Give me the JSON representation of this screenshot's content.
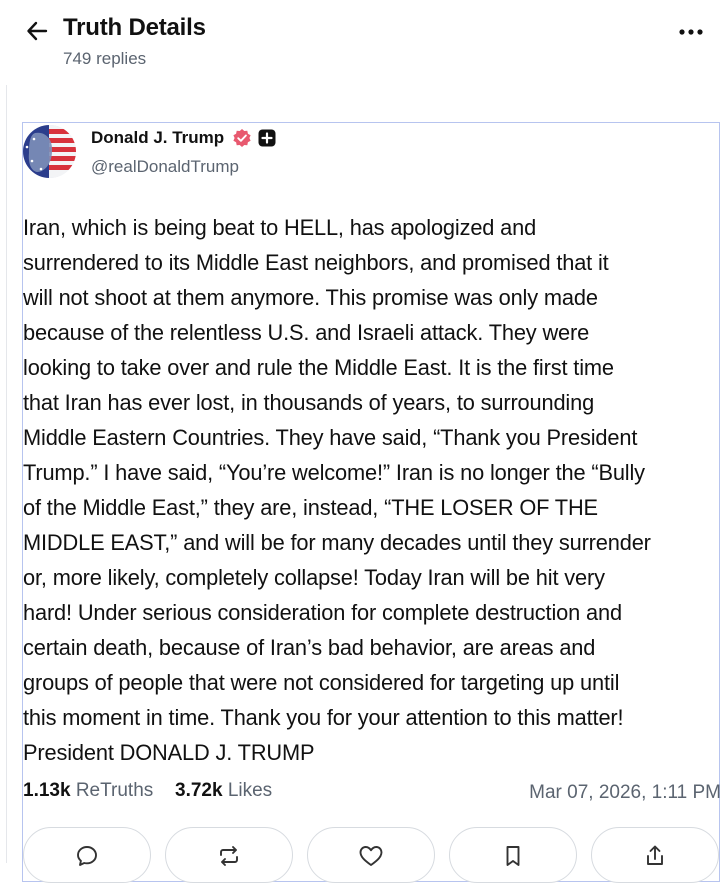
{
  "header": {
    "title": "Truth Details",
    "subtitle": "749 replies",
    "back_icon": "arrow-left-icon",
    "more_icon": "more-horizontal-icon"
  },
  "post": {
    "author": {
      "name": "Donald J. Trump",
      "handle": "@realDonaldTrump",
      "verified_icon": "verified-badge-icon",
      "plus_icon": "plus-square-icon"
    },
    "text": "Iran, which is being beat to HELL, has apologized and\nsurrendered to its Middle East neighbors, and promised that it\nwill not shoot at them anymore. This promise was only made\nbecause of the relentless U.S. and Israeli attack. They were\nlooking to take over and rule the Middle East. It is the first time\nthat Iran has ever lost, in thousands of years, to surrounding\nMiddle Eastern Countries. They have said, “Thank you President\nTrump.” I have said, “You’re welcome!” Iran is no longer the “Bully\nof the Middle East,” they are, instead, “THE LOSER OF THE\nMIDDLE EAST,” and will be for many decades until they surrender\nor, more likely, completely collapse! Today Iran will be hit very\nhard! Under serious consideration for complete destruction and\ncertain death, because of Iran’s bad behavior, are areas and\ngroups of people that were not considered for targeting up until\nthis moment in time. Thank you for your attention to this matter!\nPresident DONALD J. TRUMP",
    "stats": {
      "retruths_count": "1.13k",
      "retruths_label": "ReTruths",
      "likes_count": "3.72k",
      "likes_label": "Likes"
    },
    "timestamp": "Mar 07, 2026, 1:11 PM",
    "actions": [
      {
        "name": "reply",
        "icon": "comment-icon"
      },
      {
        "name": "retruth",
        "icon": "repost-icon"
      },
      {
        "name": "like",
        "icon": "heart-icon"
      },
      {
        "name": "bookmark",
        "icon": "bookmark-icon"
      },
      {
        "name": "share",
        "icon": "share-icon"
      }
    ]
  },
  "colors": {
    "verified": "#e8596f",
    "muted_text": "#5b6470",
    "post_border": "#b7c4ef"
  }
}
